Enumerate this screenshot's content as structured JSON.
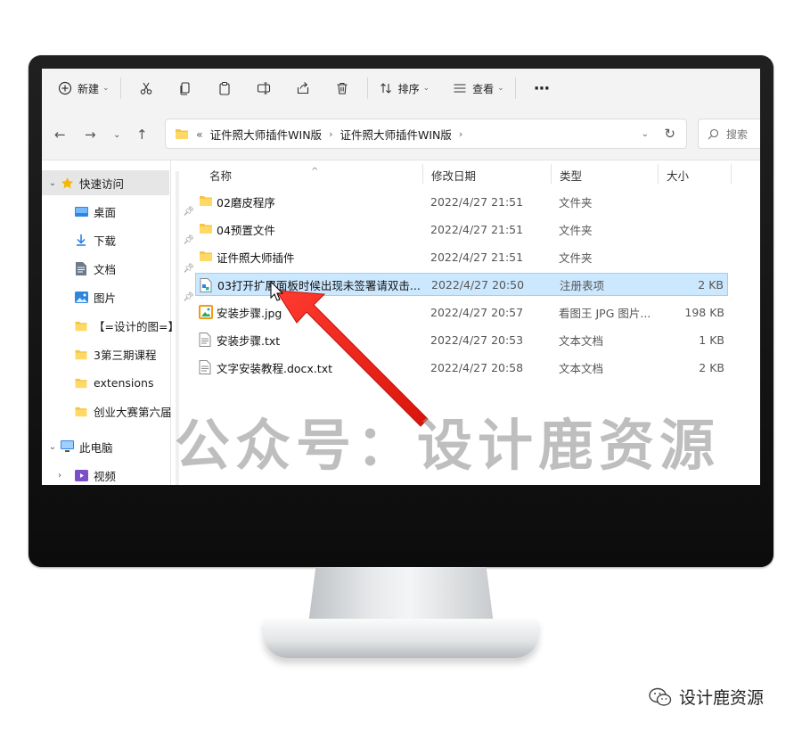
{
  "toolbar": {
    "new_label": "新建",
    "sort_label": "排序",
    "view_label": "查看",
    "more_label": "···"
  },
  "address": {
    "overflow": "«",
    "crumbs": [
      "证件照大师插件WIN版",
      "证件照大师插件WIN版"
    ],
    "search_placeholder": "搜索"
  },
  "sidebar": {
    "quick_access": "快速访问",
    "items": [
      {
        "label": "桌面",
        "icon": "desktop-icon"
      },
      {
        "label": "下载",
        "icon": "download-icon"
      },
      {
        "label": "文档",
        "icon": "document-icon"
      },
      {
        "label": "图片",
        "icon": "pictures-icon"
      },
      {
        "label": "【=设计的图=】",
        "icon": "folder-icon"
      },
      {
        "label": "3第三期课程",
        "icon": "folder-icon"
      },
      {
        "label": "extensions",
        "icon": "folder-icon"
      },
      {
        "label": "创业大赛第六届",
        "icon": "folder-icon"
      }
    ],
    "this_pc": "此电脑",
    "videos": "视频"
  },
  "columns": {
    "name": "名称",
    "modified": "修改日期",
    "type": "类型",
    "size": "大小"
  },
  "files": [
    {
      "name": "02磨皮程序",
      "date": "2022/4/27 21:51",
      "type": "文件夹",
      "size": "",
      "icon": "folder-icon"
    },
    {
      "name": "04预置文件",
      "date": "2022/4/27 21:51",
      "type": "文件夹",
      "size": "",
      "icon": "folder-icon"
    },
    {
      "name": "证件照大师插件",
      "date": "2022/4/27 21:51",
      "type": "文件夹",
      "size": "",
      "icon": "folder-icon"
    },
    {
      "name": "03打开扩展面板时候出现未签署请双击...",
      "date": "2022/4/27 20:50",
      "type": "注册表项",
      "size": "2 KB",
      "icon": "registry-file-icon"
    },
    {
      "name": "安装步骤.jpg",
      "date": "2022/4/27 20:57",
      "type": "看图王 JPG 图片...",
      "size": "198 KB",
      "icon": "image-file-icon"
    },
    {
      "name": "安装步骤.txt",
      "date": "2022/4/27 20:53",
      "type": "文本文档",
      "size": "1 KB",
      "icon": "text-file-icon"
    },
    {
      "name": "文字安装教程.docx.txt",
      "date": "2022/4/27 20:58",
      "type": "文本文档",
      "size": "2 KB",
      "icon": "text-file-icon"
    }
  ],
  "watermark": "公众号：设计鹿资源",
  "credit": "设计鹿资源",
  "colors": {
    "selection": "#cce8ff",
    "folder": "#f5c445",
    "arrow": "#e8231c",
    "accent": "#0067c0"
  }
}
